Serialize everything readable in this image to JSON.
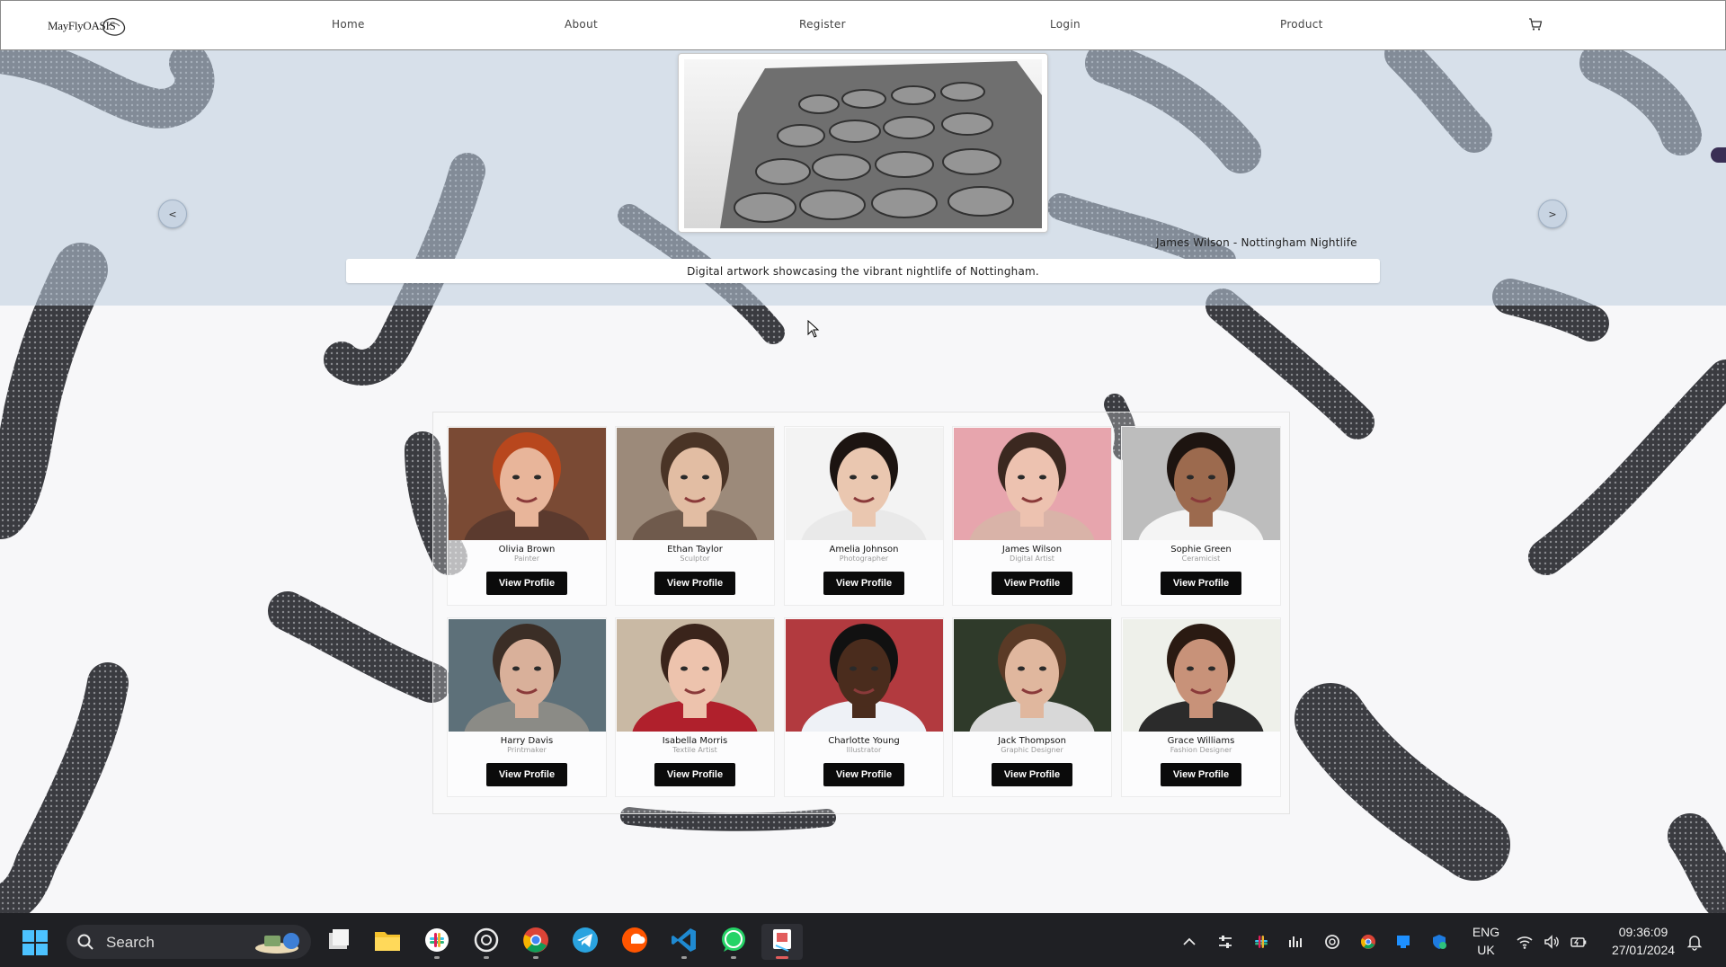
{
  "nav": {
    "logo_text": "MayFlyOASIS",
    "links": [
      "Home",
      "About",
      "Register",
      "Login",
      "Product"
    ],
    "cart_icon": "cart-icon"
  },
  "hero": {
    "prev_label": "<",
    "next_label": ">",
    "caption": "James Wilson - Nottingham Nightlife",
    "description": "Digital artwork showcasing the vibrant nightlife of Nottingham."
  },
  "profiles": [
    {
      "name": "Olivia Brown",
      "role": "Painter",
      "button": "View Profile",
      "skin": "#e8b59a",
      "hair": "#b8471d",
      "bg": "#7a4a34",
      "shirt": "#5b3a2e"
    },
    {
      "name": "Ethan Taylor",
      "role": "Sculptor",
      "button": "View Profile",
      "skin": "#e2bda3",
      "hair": "#4a3426",
      "bg": "#9c8a7a",
      "shirt": "#6f5a4c"
    },
    {
      "name": "Amelia Johnson",
      "role": "Photographer",
      "button": "View Profile",
      "skin": "#eac7b0",
      "hair": "#1c1411",
      "bg": "#f3f3f3",
      "shirt": "#e9e9e9"
    },
    {
      "name": "James Wilson",
      "role": "Digital Artist",
      "button": "View Profile",
      "skin": "#edc2b0",
      "hair": "#3b2820",
      "bg": "#e7a5ad",
      "shirt": "#d9b3a8"
    },
    {
      "name": "Sophie Green",
      "role": "Ceramicist",
      "button": "View Profile",
      "skin": "#9c6a4e",
      "hair": "#1d1410",
      "bg": "#bdbdbd",
      "shirt": "#f4f4f4"
    },
    {
      "name": "Harry Davis",
      "role": "Printmaker",
      "button": "View Profile",
      "skin": "#d9b09a",
      "hair": "#3b2e26",
      "bg": "#5d7079",
      "shirt": "#8b8b86"
    },
    {
      "name": "Isabella Morris",
      "role": "Textile Artist",
      "button": "View Profile",
      "skin": "#edc3ad",
      "hair": "#3a241b",
      "bg": "#c9b9a4",
      "shirt": "#b0202c"
    },
    {
      "name": "Charlotte Young",
      "role": "Illustrator",
      "button": "View Profile",
      "skin": "#4a2c1d",
      "hair": "#111",
      "bg": "#b23a3f",
      "shirt": "#eef1f6"
    },
    {
      "name": "Jack Thompson",
      "role": "Graphic Designer",
      "button": "View Profile",
      "skin": "#e0b79e",
      "hair": "#5a3a26",
      "bg": "#2f3a2a",
      "shirt": "#d8d8d8"
    },
    {
      "name": "Grace Williams",
      "role": "Fashion Designer",
      "button": "View Profile",
      "skin": "#c89279",
      "hair": "#2a1a12",
      "bg": "#eef0ea",
      "shirt": "#2b2b2b"
    }
  ],
  "taskbar": {
    "search_placeholder": "Search",
    "language": "ENG",
    "region": "UK",
    "time": "09:36:09",
    "date": "27/01/2024",
    "apps": [
      "files-icon",
      "file-explorer-icon",
      "slack-icon",
      "chatgpt-icon",
      "chrome-icon",
      "telegram-icon",
      "soundcloud-icon",
      "vscode-icon",
      "whatsapp-icon",
      "snipping-tool-icon"
    ]
  },
  "colors": {
    "accent_dark": "#0b0b0b",
    "hero_tint": "#c7d3e1",
    "taskbar": "#1f2024"
  }
}
